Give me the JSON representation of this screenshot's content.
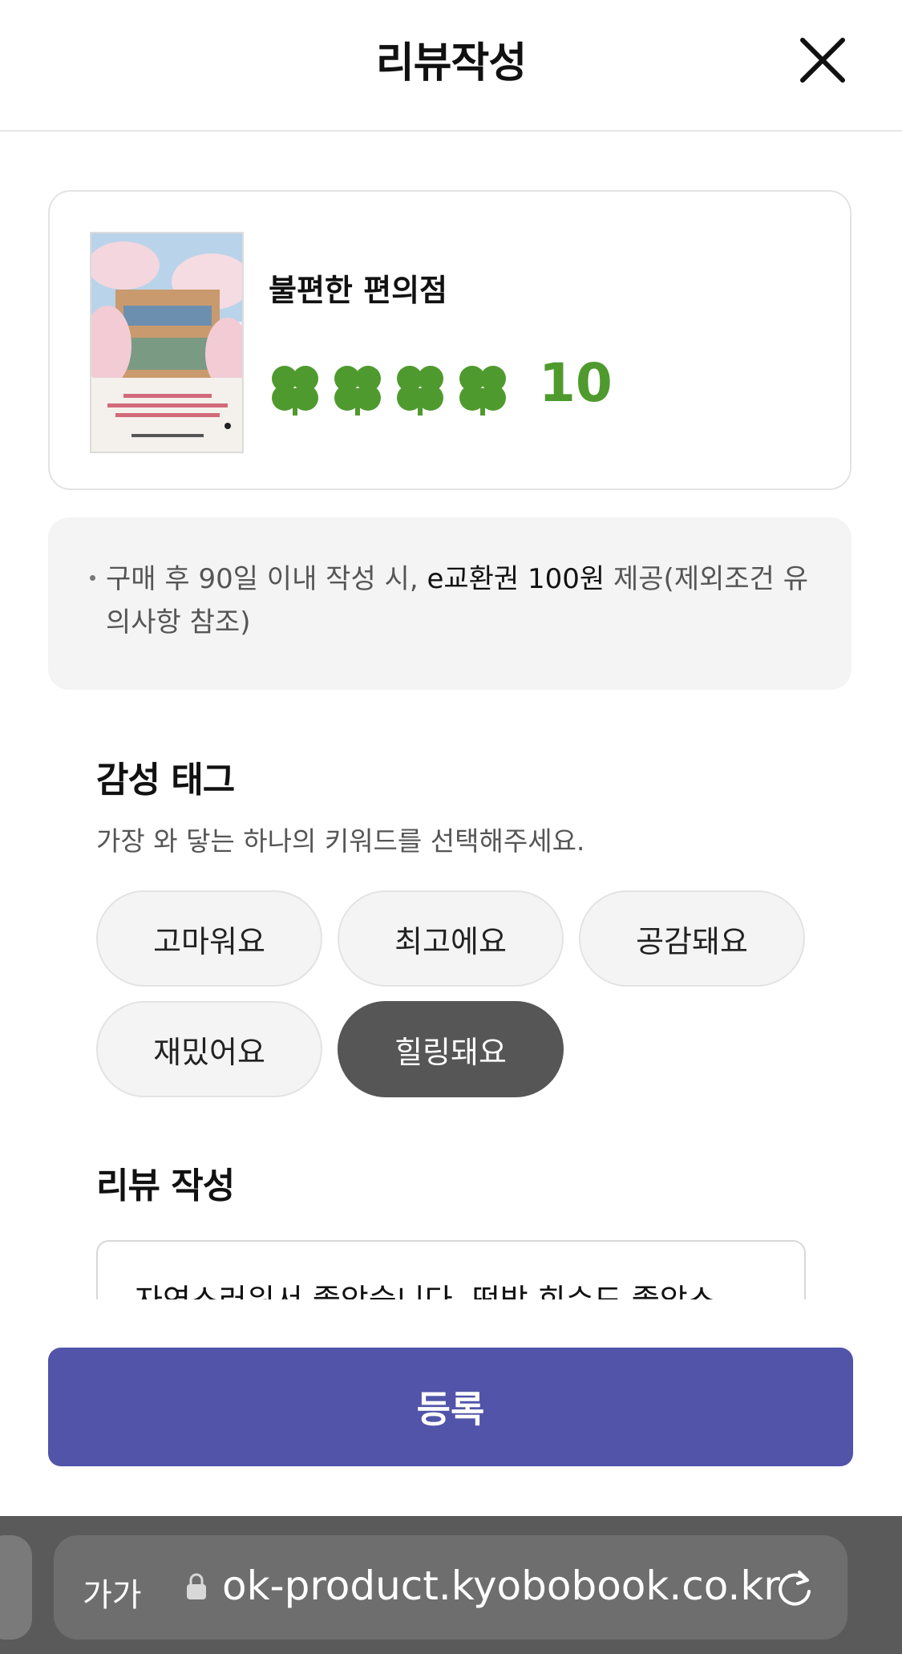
{
  "header": {
    "title": "리뷰작성"
  },
  "product": {
    "name": "불편한 편의점",
    "rating": "10",
    "clover_count": 4,
    "clover_color": "#4f9a2e"
  },
  "notice": {
    "text_before": "구매 후 90일 이내 작성 시, ",
    "text_highlight": "e교환권 100원",
    "text_after": " 제공(제외조건 유의사항 참조)"
  },
  "tags": {
    "title": "감성 태그",
    "subtitle": "가장 와 닿는 하나의 키워드를 선택해주세요.",
    "items": [
      {
        "label": "고마워요",
        "selected": false
      },
      {
        "label": "최고에요",
        "selected": false
      },
      {
        "label": "공감돼요",
        "selected": false
      },
      {
        "label": "재밌어요",
        "selected": false
      },
      {
        "label": "힐링돼요",
        "selected": true
      }
    ]
  },
  "review": {
    "title": "리뷰 작성",
    "text": "자연스러워서 좋았습니다. 떡밥 회수도 좋았스"
  },
  "submit": {
    "label": "등록"
  },
  "browser": {
    "aa_label": "가가",
    "url": "ok-product.kyobobook.co.kr"
  },
  "colors": {
    "submit": "#5154a9",
    "selected_chip": "#565656",
    "rating": "#4f9a2e"
  }
}
